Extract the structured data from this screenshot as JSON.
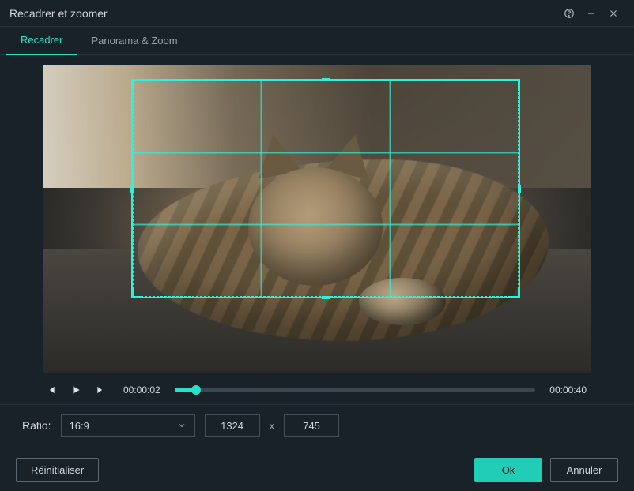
{
  "window": {
    "title": "Recadrer et zoomer"
  },
  "tabs": {
    "crop": "Recadrer",
    "panzoom": "Panorama & Zoom",
    "active": "crop"
  },
  "playback": {
    "current_time": "00:00:02",
    "total_time": "00:00:40",
    "progress_percent": 6
  },
  "ratio": {
    "label": "Ratio:",
    "selected": "16:9",
    "width": "1324",
    "by": "x",
    "height": "745"
  },
  "footer": {
    "reset": "Réinitialiser",
    "ok": "Ok",
    "cancel": "Annuler"
  },
  "icons": {
    "help": "help-icon",
    "minimize": "minimize-icon",
    "close": "close-icon"
  }
}
